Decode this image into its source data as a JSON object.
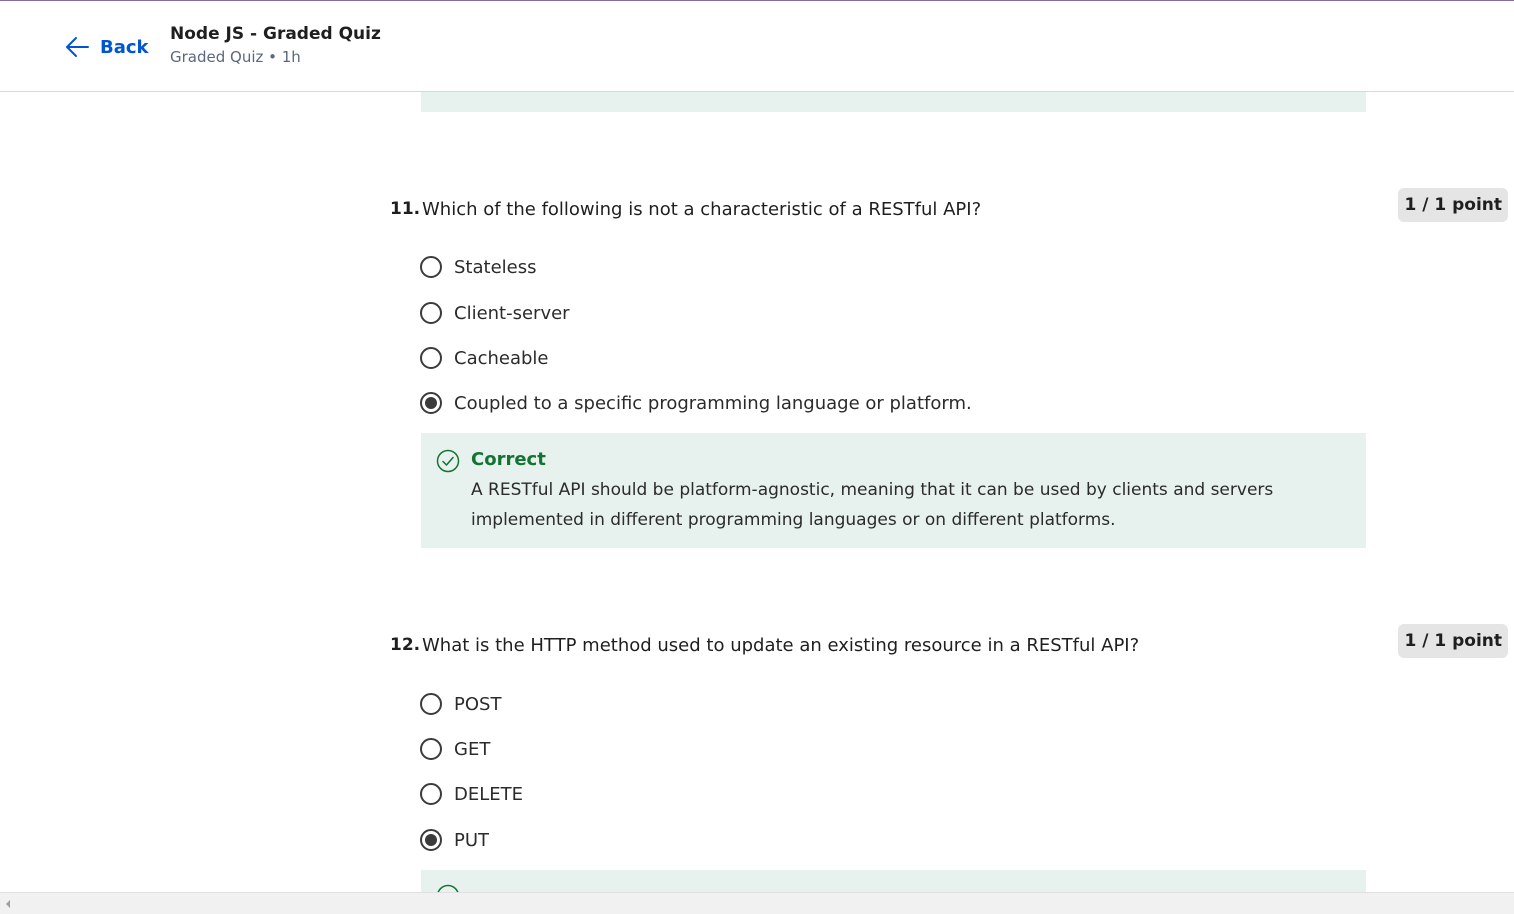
{
  "header": {
    "back_label": "Back",
    "course_title": "Node JS - Graded Quiz",
    "course_subtitle": "Graded Quiz • 1h"
  },
  "questions": [
    {
      "number": "11.",
      "text": "Which of the following is not a characteristic of a RESTful API?",
      "points": "1 / 1 point",
      "options": [
        {
          "label": "Stateless",
          "selected": false
        },
        {
          "label": "Client-server",
          "selected": false
        },
        {
          "label": "Cacheable",
          "selected": false
        },
        {
          "label": "Coupled to a specific programming language or platform.",
          "selected": true
        }
      ],
      "feedback": {
        "status": "Correct",
        "explanation": "A RESTful API should be platform-agnostic, meaning that it can be used by clients and servers implemented in different programming languages or on different platforms."
      }
    },
    {
      "number": "12.",
      "text": "What is the HTTP method used to update an existing resource in a RESTful API?",
      "points": "1 / 1 point",
      "options": [
        {
          "label": "POST",
          "selected": false
        },
        {
          "label": "GET",
          "selected": false
        },
        {
          "label": "DELETE",
          "selected": false
        },
        {
          "label": "PUT",
          "selected": true
        }
      ]
    }
  ],
  "colors": {
    "accent": "#0056d2",
    "correct": "#137333",
    "feedback_bg": "#e7f1ed"
  }
}
